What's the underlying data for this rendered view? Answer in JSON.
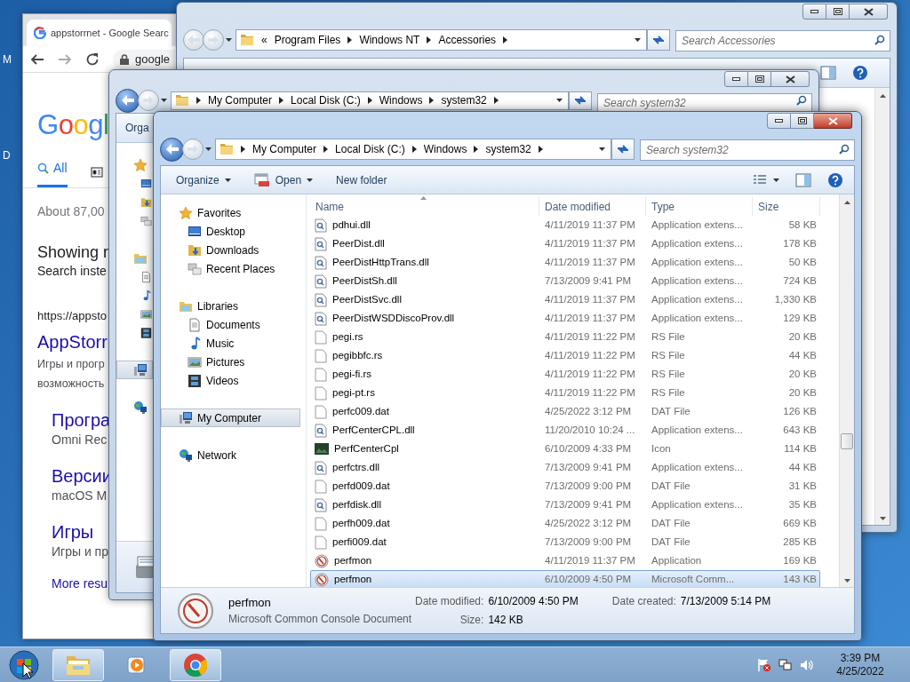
{
  "desktop": {
    "icon_labels": [
      "M",
      "D"
    ]
  },
  "browser": {
    "tab_title": "appstorrnet - Google Searc",
    "address": "google",
    "logo": "Googl",
    "search_tabs": [
      {
        "kind": "search",
        "label": "All",
        "selected": true
      },
      {
        "kind": "news",
        "selected": false
      }
    ],
    "result_stats": "About 87,00",
    "spelling": {
      "title": "Showing r",
      "subtitle": "Search inste"
    },
    "result": {
      "url": "https://appsto",
      "title": "AppStorr",
      "snippet_lines": [
        "Игры и прогр",
        "возможность"
      ],
      "sitelinks": [
        {
          "title": "Програ",
          "snippet": "Omni Rec"
        },
        {
          "title": "Версии",
          "snippet": "macOS M"
        },
        {
          "title": "Игры",
          "snippet": "Игры и пр"
        }
      ],
      "more": "More resu"
    }
  },
  "accessories_window": {
    "active": false,
    "back_enabled": false,
    "address": {
      "overflow": "«",
      "segments": [
        "Program Files",
        "Windows NT",
        "Accessories"
      ]
    },
    "search_placeholder": "Search Accessories"
  },
  "system32_window": {
    "active": false,
    "back_enabled": true,
    "address": {
      "segments": [
        "My Computer",
        "Local Disk (C:)",
        "Windows",
        "system32"
      ]
    },
    "search_placeholder": "Search system32",
    "command": "Orga",
    "sidebar": [
      {
        "kind": "favorites",
        "selected": false,
        "children": [
          {
            "kind": "desktop",
            "selected": false
          },
          {
            "kind": "downloads",
            "selected": false
          },
          {
            "kind": "recent",
            "selected": false
          }
        ]
      },
      {
        "kind": "libraries",
        "selected": false,
        "children": [
          {
            "kind": "documents",
            "selected": false
          },
          {
            "kind": "music",
            "selected": false
          },
          {
            "kind": "pictures",
            "selected": false
          },
          {
            "kind": "videos",
            "selected": false
          }
        ]
      },
      {
        "kind": "computer",
        "selected": true
      },
      {
        "kind": "network",
        "selected": false
      }
    ]
  },
  "explorer": {
    "active": true,
    "back_enabled": true,
    "address": {
      "segments": [
        "My Computer",
        "Local Disk (C:)",
        "Windows",
        "system32"
      ]
    },
    "search_placeholder": "Search system32",
    "commands": [
      {
        "kind": "menu",
        "label": "Organize"
      },
      {
        "kind": "open",
        "label": "Open"
      },
      {
        "kind": "plain",
        "label": "New folder"
      }
    ],
    "sidebar": [
      {
        "kind": "favorites",
        "label": "Favorites",
        "selected": false,
        "children": [
          {
            "kind": "desktop",
            "label": "Desktop",
            "selected": false
          },
          {
            "kind": "downloads",
            "label": "Downloads",
            "selected": false
          },
          {
            "kind": "recent",
            "label": "Recent Places",
            "selected": false
          }
        ]
      },
      {
        "kind": "libraries",
        "label": "Libraries",
        "selected": false,
        "children": [
          {
            "kind": "documents",
            "label": "Documents",
            "selected": false
          },
          {
            "kind": "music",
            "label": "Music",
            "selected": false
          },
          {
            "kind": "pictures",
            "label": "Pictures",
            "selected": false
          },
          {
            "kind": "videos",
            "label": "Videos",
            "selected": false
          }
        ]
      },
      {
        "kind": "computer",
        "label": "My Computer",
        "selected": true
      },
      {
        "kind": "network",
        "label": "Network",
        "selected": false
      }
    ],
    "columns": [
      "Name",
      "Date modified",
      "Type",
      "Size"
    ],
    "rows": [
      {
        "kind": "dll",
        "name": "pdhui.dll",
        "date": "4/11/2019 11:37 PM",
        "type": "Application extens...",
        "size": "58 KB",
        "selected": false
      },
      {
        "kind": "dll",
        "name": "PeerDist.dll",
        "date": "4/11/2019 11:37 PM",
        "type": "Application extens...",
        "size": "178 KB",
        "selected": false
      },
      {
        "kind": "dll",
        "name": "PeerDistHttpTrans.dll",
        "date": "4/11/2019 11:37 PM",
        "type": "Application extens...",
        "size": "50 KB",
        "selected": false
      },
      {
        "kind": "dll",
        "name": "PeerDistSh.dll",
        "date": "7/13/2009 9:41 PM",
        "type": "Application extens...",
        "size": "724 KB",
        "selected": false
      },
      {
        "kind": "dll",
        "name": "PeerDistSvc.dll",
        "date": "4/11/2019 11:37 PM",
        "type": "Application extens...",
        "size": "1,330 KB",
        "selected": false
      },
      {
        "kind": "dll",
        "name": "PeerDistWSDDiscoProv.dll",
        "date": "4/11/2019 11:37 PM",
        "type": "Application extens...",
        "size": "129 KB",
        "selected": false
      },
      {
        "kind": "file",
        "name": "pegi.rs",
        "date": "4/11/2019 11:22 PM",
        "type": "RS File",
        "size": "20 KB",
        "selected": false
      },
      {
        "kind": "file",
        "name": "pegibbfc.rs",
        "date": "4/11/2019 11:22 PM",
        "type": "RS File",
        "size": "44 KB",
        "selected": false
      },
      {
        "kind": "file",
        "name": "pegi-fi.rs",
        "date": "4/11/2019 11:22 PM",
        "type": "RS File",
        "size": "20 KB",
        "selected": false
      },
      {
        "kind": "file",
        "name": "pegi-pt.rs",
        "date": "4/11/2019 11:22 PM",
        "type": "RS File",
        "size": "20 KB",
        "selected": false
      },
      {
        "kind": "file",
        "name": "perfc009.dat",
        "date": "4/25/2022 3:12 PM",
        "type": "DAT File",
        "size": "126 KB",
        "selected": false
      },
      {
        "kind": "dll",
        "name": "PerfCenterCPL.dll",
        "date": "11/20/2010 10:24 ...",
        "type": "Application extens...",
        "size": "643 KB",
        "selected": false
      },
      {
        "kind": "icon",
        "name": "PerfCenterCpl",
        "date": "6/10/2009 4:33 PM",
        "type": "Icon",
        "size": "114 KB",
        "selected": false
      },
      {
        "kind": "dll",
        "name": "perfctrs.dll",
        "date": "7/13/2009 9:41 PM",
        "type": "Application extens...",
        "size": "44 KB",
        "selected": false
      },
      {
        "kind": "file",
        "name": "perfd009.dat",
        "date": "7/13/2009 9:00 PM",
        "type": "DAT File",
        "size": "31 KB",
        "selected": false
      },
      {
        "kind": "dll",
        "name": "perfdisk.dll",
        "date": "7/13/2009 9:41 PM",
        "type": "Application extens...",
        "size": "35 KB",
        "selected": false
      },
      {
        "kind": "file",
        "name": "perfh009.dat",
        "date": "4/25/2022 3:12 PM",
        "type": "DAT File",
        "size": "669 KB",
        "selected": false
      },
      {
        "kind": "file",
        "name": "perfi009.dat",
        "date": "7/13/2009 9:00 PM",
        "type": "DAT File",
        "size": "285 KB",
        "selected": false
      },
      {
        "kind": "app",
        "name": "perfmon",
        "date": "4/11/2019 11:37 PM",
        "type": "Application",
        "size": "169 KB",
        "selected": false
      },
      {
        "kind": "console",
        "name": "perfmon",
        "date": "6/10/2009 4:50 PM",
        "type": "Microsoft Comm...",
        "size": "143 KB",
        "selected": true
      }
    ],
    "details": {
      "name": "perfmon",
      "type": "Microsoft Common Console Document",
      "fields": [
        {
          "label": "Date modified:",
          "value": "6/10/2009 4:50 PM"
        },
        {
          "label": "Date created:",
          "value": "7/13/2009 5:14 PM"
        },
        {
          "label": "Size:",
          "value": "142 KB"
        }
      ]
    }
  },
  "taskbar": {
    "apps": [
      {
        "kind": "explorer",
        "running": true
      },
      {
        "kind": "media",
        "running": false
      },
      {
        "kind": "chrome",
        "running": true
      }
    ],
    "time": "3:39 PM",
    "date": "4/25/2022"
  }
}
